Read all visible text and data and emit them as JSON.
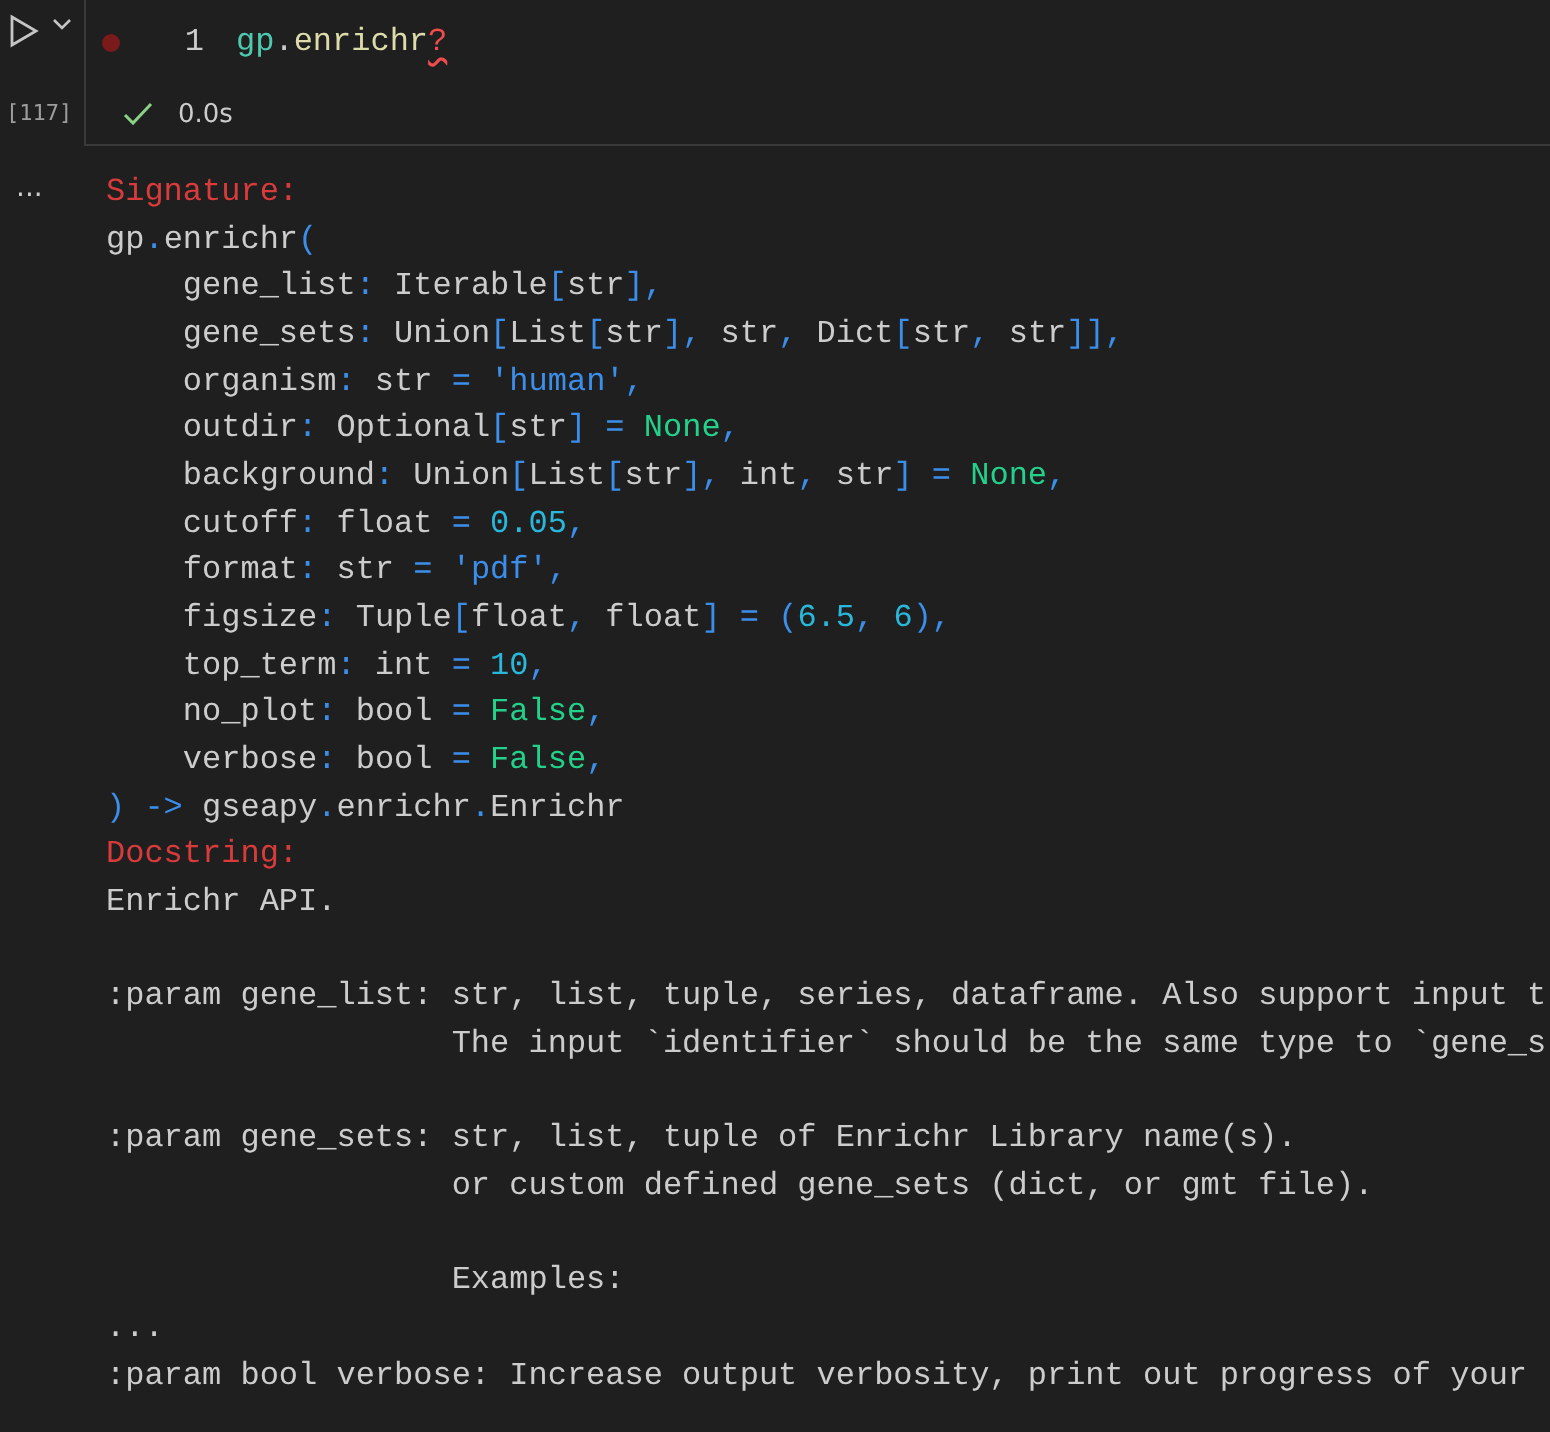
{
  "cell": {
    "execution_count": "[117]",
    "breakpoint": true,
    "line_number": "1",
    "code": [
      {
        "kind": "module",
        "text": "gp"
      },
      {
        "kind": "plain",
        "text": "."
      },
      {
        "kind": "func",
        "text": "enrichr"
      },
      {
        "kind": "error",
        "text": "?"
      }
    ],
    "status": {
      "kind": "success",
      "time": "0.0s"
    }
  },
  "output": {
    "more": "...",
    "lines": [
      {
        "tokens": [
          {
            "kind": "header",
            "text": "Signature:"
          }
        ]
      },
      {
        "tokens": [
          {
            "kind": "t",
            "text": "gp"
          },
          {
            "kind": "p",
            "text": "."
          },
          {
            "kind": "t",
            "text": "enrichr"
          },
          {
            "kind": "p",
            "text": "("
          }
        ]
      },
      {
        "tokens": [
          {
            "kind": "t",
            "text": "    gene_list"
          },
          {
            "kind": "p",
            "text": ":"
          },
          {
            "kind": "t",
            "text": " Iterable"
          },
          {
            "kind": "p",
            "text": "["
          },
          {
            "kind": "t",
            "text": "str"
          },
          {
            "kind": "p",
            "text": "],"
          }
        ]
      },
      {
        "tokens": [
          {
            "kind": "t",
            "text": "    gene_sets"
          },
          {
            "kind": "p",
            "text": ":"
          },
          {
            "kind": "t",
            "text": " Union"
          },
          {
            "kind": "p",
            "text": "["
          },
          {
            "kind": "t",
            "text": "List"
          },
          {
            "kind": "p",
            "text": "["
          },
          {
            "kind": "t",
            "text": "str"
          },
          {
            "kind": "p",
            "text": "],"
          },
          {
            "kind": "t",
            "text": " str"
          },
          {
            "kind": "p",
            "text": ","
          },
          {
            "kind": "t",
            "text": " Dict"
          },
          {
            "kind": "p",
            "text": "["
          },
          {
            "kind": "t",
            "text": "str"
          },
          {
            "kind": "p",
            "text": ","
          },
          {
            "kind": "t",
            "text": " str"
          },
          {
            "kind": "p",
            "text": "]],"
          }
        ]
      },
      {
        "tokens": [
          {
            "kind": "t",
            "text": "    organism"
          },
          {
            "kind": "p",
            "text": ":"
          },
          {
            "kind": "t",
            "text": " str "
          },
          {
            "kind": "p",
            "text": "="
          },
          {
            "kind": "s",
            "text": " 'human'"
          },
          {
            "kind": "p",
            "text": ","
          }
        ]
      },
      {
        "tokens": [
          {
            "kind": "t",
            "text": "    outdir"
          },
          {
            "kind": "p",
            "text": ":"
          },
          {
            "kind": "t",
            "text": " Optional"
          },
          {
            "kind": "p",
            "text": "["
          },
          {
            "kind": "t",
            "text": "str"
          },
          {
            "kind": "p",
            "text": "] ="
          },
          {
            "kind": "k",
            "text": " None"
          },
          {
            "kind": "p",
            "text": ","
          }
        ]
      },
      {
        "tokens": [
          {
            "kind": "t",
            "text": "    background"
          },
          {
            "kind": "p",
            "text": ":"
          },
          {
            "kind": "t",
            "text": " Union"
          },
          {
            "kind": "p",
            "text": "["
          },
          {
            "kind": "t",
            "text": "List"
          },
          {
            "kind": "p",
            "text": "["
          },
          {
            "kind": "t",
            "text": "str"
          },
          {
            "kind": "p",
            "text": "],"
          },
          {
            "kind": "t",
            "text": " int"
          },
          {
            "kind": "p",
            "text": ","
          },
          {
            "kind": "t",
            "text": " str"
          },
          {
            "kind": "p",
            "text": "] ="
          },
          {
            "kind": "k",
            "text": " None"
          },
          {
            "kind": "p",
            "text": ","
          }
        ]
      },
      {
        "tokens": [
          {
            "kind": "t",
            "text": "    cutoff"
          },
          {
            "kind": "p",
            "text": ":"
          },
          {
            "kind": "t",
            "text": " float "
          },
          {
            "kind": "p",
            "text": "="
          },
          {
            "kind": "n",
            "text": " 0.05"
          },
          {
            "kind": "p",
            "text": ","
          }
        ]
      },
      {
        "tokens": [
          {
            "kind": "t",
            "text": "    format"
          },
          {
            "kind": "p",
            "text": ":"
          },
          {
            "kind": "t",
            "text": " str "
          },
          {
            "kind": "p",
            "text": "="
          },
          {
            "kind": "s",
            "text": " 'pdf'"
          },
          {
            "kind": "p",
            "text": ","
          }
        ]
      },
      {
        "tokens": [
          {
            "kind": "t",
            "text": "    figsize"
          },
          {
            "kind": "p",
            "text": ":"
          },
          {
            "kind": "t",
            "text": " Tuple"
          },
          {
            "kind": "p",
            "text": "["
          },
          {
            "kind": "t",
            "text": "float"
          },
          {
            "kind": "p",
            "text": ","
          },
          {
            "kind": "t",
            "text": " float"
          },
          {
            "kind": "p",
            "text": "] = ("
          },
          {
            "kind": "n",
            "text": "6.5"
          },
          {
            "kind": "p",
            "text": ","
          },
          {
            "kind": "n",
            "text": " 6"
          },
          {
            "kind": "p",
            "text": "),"
          }
        ]
      },
      {
        "tokens": [
          {
            "kind": "t",
            "text": "    top_term"
          },
          {
            "kind": "p",
            "text": ":"
          },
          {
            "kind": "t",
            "text": " int "
          },
          {
            "kind": "p",
            "text": "="
          },
          {
            "kind": "n",
            "text": " 10"
          },
          {
            "kind": "p",
            "text": ","
          }
        ]
      },
      {
        "tokens": [
          {
            "kind": "t",
            "text": "    no_plot"
          },
          {
            "kind": "p",
            "text": ":"
          },
          {
            "kind": "t",
            "text": " bool "
          },
          {
            "kind": "p",
            "text": "="
          },
          {
            "kind": "k",
            "text": " False"
          },
          {
            "kind": "p",
            "text": ","
          }
        ]
      },
      {
        "tokens": [
          {
            "kind": "t",
            "text": "    verbose"
          },
          {
            "kind": "p",
            "text": ":"
          },
          {
            "kind": "t",
            "text": " bool "
          },
          {
            "kind": "p",
            "text": "="
          },
          {
            "kind": "k",
            "text": " False"
          },
          {
            "kind": "p",
            "text": ","
          }
        ]
      },
      {
        "tokens": [
          {
            "kind": "p",
            "text": ") ->"
          },
          {
            "kind": "t",
            "text": " gseapy"
          },
          {
            "kind": "p",
            "text": "."
          },
          {
            "kind": "t",
            "text": "enrichr"
          },
          {
            "kind": "p",
            "text": "."
          },
          {
            "kind": "t",
            "text": "Enrichr"
          }
        ]
      },
      {
        "tokens": [
          {
            "kind": "header",
            "text": "Docstring:"
          }
        ]
      },
      {
        "tokens": [
          {
            "kind": "t",
            "text": "Enrichr API."
          }
        ]
      },
      {
        "kind": "blank"
      },
      {
        "tokens": [
          {
            "kind": "t",
            "text": ":param gene_list: str, list, tuple, series, dataframe. Also support input t"
          }
        ]
      },
      {
        "tokens": [
          {
            "kind": "t",
            "text": "                  The input `identifier` should be the same type to `gene_s"
          }
        ]
      },
      {
        "kind": "blank"
      },
      {
        "tokens": [
          {
            "kind": "t",
            "text": ":param gene_sets: str, list, tuple of Enrichr Library name(s)."
          }
        ]
      },
      {
        "tokens": [
          {
            "kind": "t",
            "text": "                  or custom defined gene_sets (dict, or gmt file)."
          }
        ]
      },
      {
        "kind": "blank"
      },
      {
        "tokens": [
          {
            "kind": "t",
            "text": "                  Examples:"
          }
        ]
      },
      {
        "tokens": [
          {
            "kind": "t",
            "text": "..."
          }
        ]
      },
      {
        "tokens": [
          {
            "kind": "t",
            "text": ":param bool verbose: Increase output verbosity, print out progress of your"
          }
        ]
      }
    ]
  }
}
